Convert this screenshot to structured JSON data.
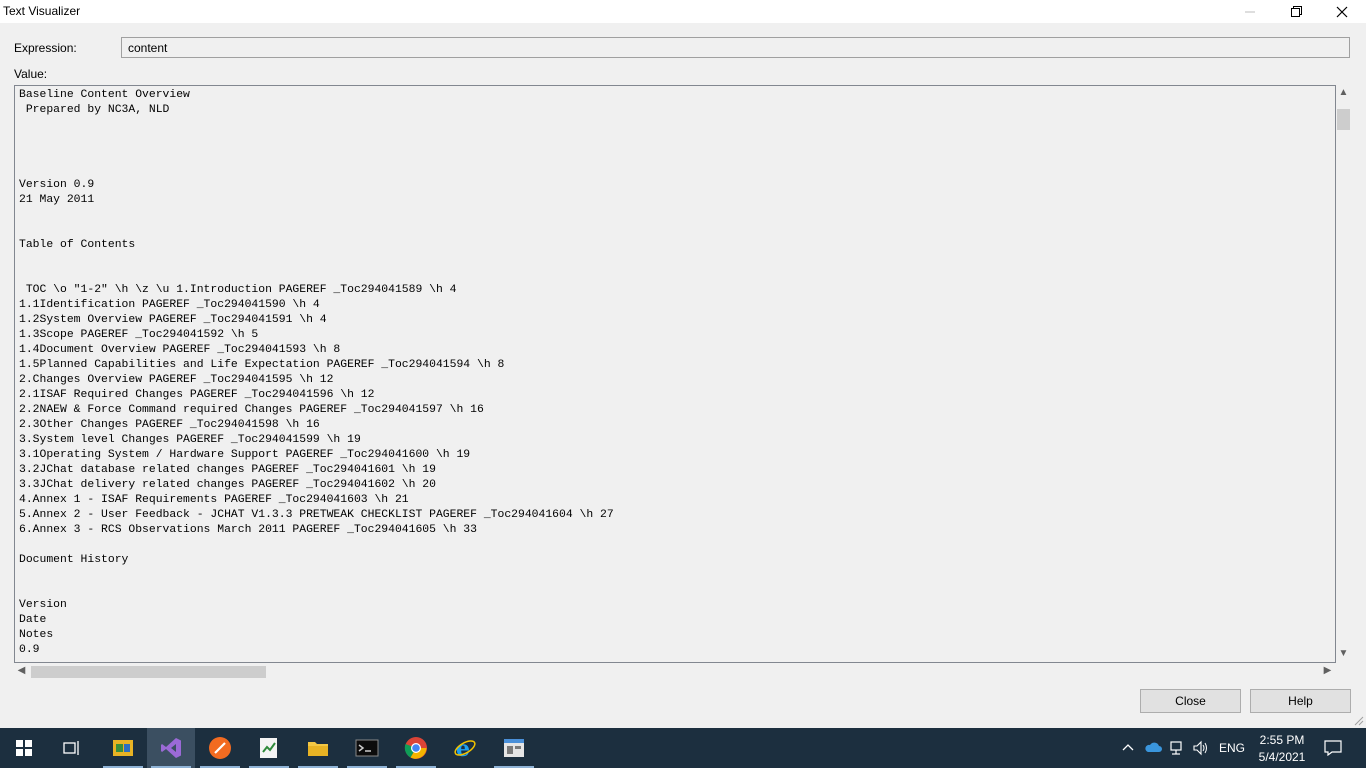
{
  "window": {
    "title": "Text Visualizer",
    "controls": {
      "minimize": "minimize-icon",
      "restore": "restore-icon",
      "close": "close-icon"
    }
  },
  "expression": {
    "label": "Expression:",
    "value": "content"
  },
  "value": {
    "label": "Value:",
    "text": "Baseline Content Overview\n Prepared by NC3A, NLD\n\n\n\n\nVersion 0.9\n21 May 2011\n\n\nTable of Contents\n\n\n TOC \\o \"1-2\" \\h \\z \\u 1.Introduction PAGEREF _Toc294041589 \\h 4\n1.1Identification PAGEREF _Toc294041590 \\h 4\n1.2System Overview PAGEREF _Toc294041591 \\h 4\n1.3Scope PAGEREF _Toc294041592 \\h 5\n1.4Document Overview PAGEREF _Toc294041593 \\h 8\n1.5Planned Capabilities and Life Expectation PAGEREF _Toc294041594 \\h 8\n2.Changes Overview PAGEREF _Toc294041595 \\h 12\n2.1ISAF Required Changes PAGEREF _Toc294041596 \\h 12\n2.2NAEW & Force Command required Changes PAGEREF _Toc294041597 \\h 16\n2.3Other Changes PAGEREF _Toc294041598 \\h 16\n3.System level Changes PAGEREF _Toc294041599 \\h 19\n3.1Operating System / Hardware Support PAGEREF _Toc294041600 \\h 19\n3.2JChat database related changes PAGEREF _Toc294041601 \\h 19\n3.3JChat delivery related changes PAGEREF _Toc294041602 \\h 20\n4.Annex 1 - ISAF Requirements PAGEREF _Toc294041603 \\h 21\n5.Annex 2 - User Feedback - JCHAT V1.3.3 PRETWEAK CHECKLIST PAGEREF _Toc294041604 \\h 27\n6.Annex 3 - RCS Observations March 2011 PAGEREF _Toc294041605 \\h 33\n\nDocument History\n\n\nVersion\nDate\nNotes\n0.9"
  },
  "buttons": {
    "close": "Close",
    "help": "Help"
  },
  "taskbar": {
    "apps": [
      "windows-start-icon",
      "task-view-icon",
      "app-icon",
      "visual-studio-icon",
      "app-icon",
      "app-icon",
      "file-explorer-icon",
      "terminal-icon",
      "chrome-icon",
      "internet-explorer-icon",
      "app-icon"
    ],
    "tray": {
      "language": "ENG",
      "time": "2:55 PM",
      "date": "5/4/2021"
    }
  },
  "colors": {
    "taskbar": "#1c2f3f",
    "window_bg": "#f0f0f0",
    "accent": "#0078d7"
  }
}
